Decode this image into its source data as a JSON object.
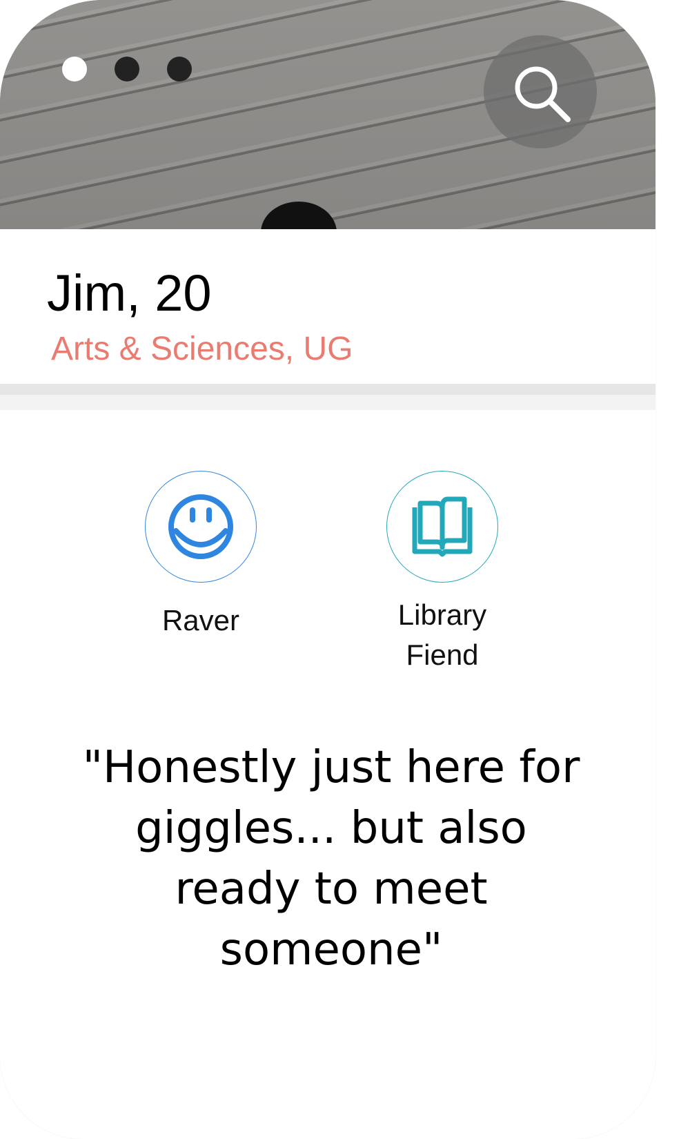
{
  "profile": {
    "name_age": "Jim, 20",
    "school": "Arts & Sciences, UG",
    "quote": "\"Honestly just here for giggles... but also ready to meet someone\""
  },
  "carousel": {
    "dot_count": 3,
    "active_index": 0
  },
  "badges": [
    {
      "label": "Raver",
      "icon": "smiley-icon",
      "color": "#2f86e0"
    },
    {
      "label": "Library\nFiend",
      "icon": "open-book-icon",
      "color": "#22a8b8"
    }
  ],
  "colors": {
    "accent": "#ea7b70"
  },
  "icons": {
    "search": "search-icon"
  }
}
